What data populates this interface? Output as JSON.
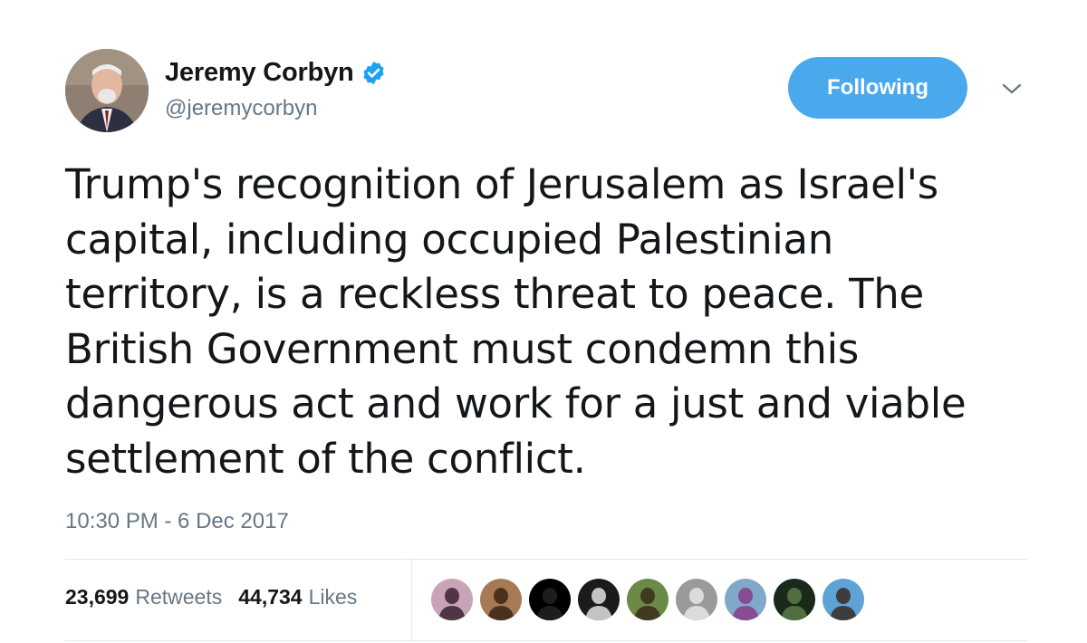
{
  "author": {
    "display_name": "Jeremy Corbyn",
    "handle": "@jeremycorbyn",
    "verified": true
  },
  "follow_button": {
    "label": "Following",
    "color": "#4aa8ec"
  },
  "menu": {
    "icon": "chevron-down-icon"
  },
  "tweet": {
    "text": "Trump's recognition of Jerusalem as Israel's\ncapital, including occupied Palestinian\nterritory, is a reckless threat to peace. The\nBritish Government must condemn this\ndangerous act and work for a just and viable\nsettlement of the conflict.",
    "timestamp": "10:30 PM - 6 Dec 2017"
  },
  "stats": {
    "retweets_count": "23,699",
    "retweets_label": "Retweets",
    "likes_count": "44,734",
    "likes_label": "Likes"
  },
  "likers": [
    {
      "name": "liker-avatar-1",
      "bg": "#c9a3b8",
      "fg": "#3a2230"
    },
    {
      "name": "liker-avatar-2",
      "bg": "#a77a55",
      "fg": "#3b2618"
    },
    {
      "name": "liker-avatar-3",
      "bg": "#000000",
      "fg": "#222222"
    },
    {
      "name": "liker-avatar-4",
      "bg": "#1b1b1b",
      "fg": "#e0e0e0"
    },
    {
      "name": "liker-avatar-5",
      "bg": "#6b8a45",
      "fg": "#3a2a1a"
    },
    {
      "name": "liker-avatar-6",
      "bg": "#9a9a9a",
      "fg": "#e6e6e6"
    },
    {
      "name": "liker-avatar-7",
      "bg": "#7fa8c9",
      "fg": "#8a3c8a"
    },
    {
      "name": "liker-avatar-8",
      "bg": "#1a2a1a",
      "fg": "#5a7a4a"
    },
    {
      "name": "liker-avatar-9",
      "bg": "#5fa3d6",
      "fg": "#3a2a22"
    }
  ],
  "colors": {
    "text": "#14171a",
    "secondary": "#657786",
    "verified": "#1da1f2",
    "divider": "#e1e8ed"
  }
}
